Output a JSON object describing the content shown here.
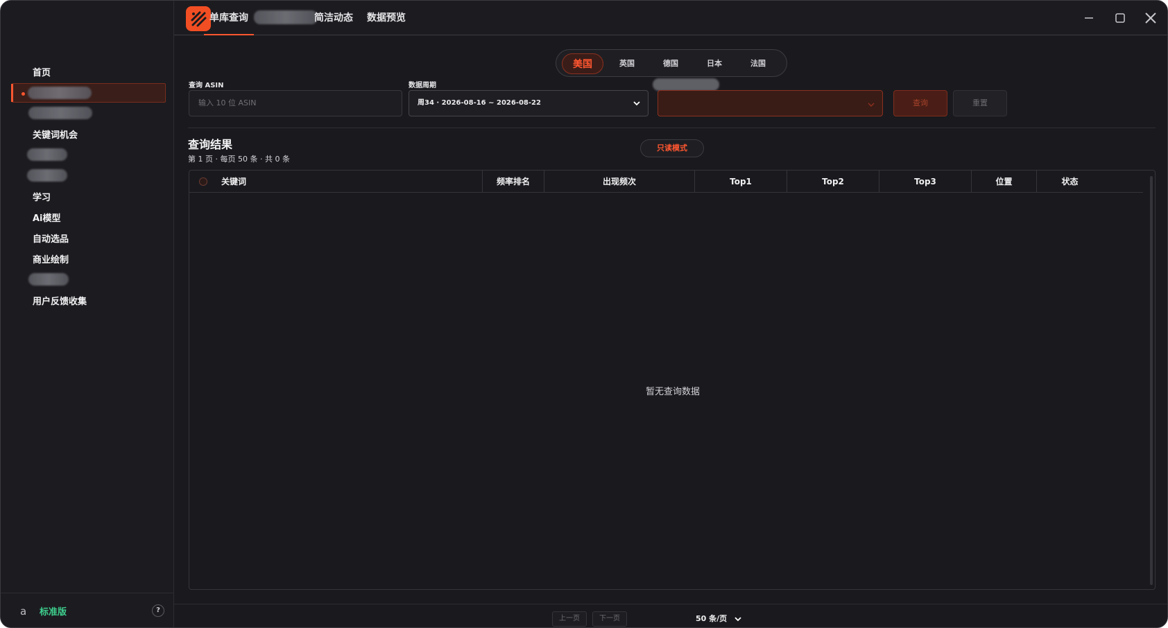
{
  "topbar": {
    "tabs": [
      {
        "label": "单库查询",
        "active": true
      },
      {
        "label": "",
        "blurred": true
      },
      {
        "label": "简洁动态"
      },
      {
        "label": "数据预览"
      }
    ]
  },
  "sidebar": {
    "items": [
      {
        "label": "首页"
      },
      {
        "label": "",
        "blurred": true,
        "active": true
      },
      {
        "label": "",
        "blurred": true
      },
      {
        "label": "关键词机会"
      },
      {
        "label": "",
        "blurred": true
      },
      {
        "label": "",
        "blurred": true
      },
      {
        "label": "学习"
      },
      {
        "label": "Ai模型"
      },
      {
        "label": "自动选品"
      },
      {
        "label": "商业绘制"
      },
      {
        "label": "",
        "blurred": true
      },
      {
        "label": "用户反馈收集"
      }
    ],
    "footer": {
      "edition": "标准版",
      "help": "?",
      "amazon_icon": "a"
    }
  },
  "countries": [
    "美国",
    "英国",
    "德国",
    "日本",
    "法国"
  ],
  "form": {
    "asin_label": "查询 ASIN",
    "asin_placeholder": "输入 10 位 ASIN",
    "period_label": "数据周期",
    "period_value": "周34 · 2026-08-16 ~ 2026-08-22",
    "query_button": "查询",
    "reset_button": "重置"
  },
  "results": {
    "title": "查询结果",
    "subtitle": "第 1 页 · 每页 50 条 · 共 0 条",
    "readonly_badge": "只读模式",
    "columns": [
      "关键词",
      "频率排名",
      "出现频次",
      "Top1",
      "Top2",
      "Top3",
      "位置",
      "状态"
    ],
    "empty_text": "暂无查询数据"
  },
  "pager": {
    "prev": "上一页",
    "next": "下一页",
    "page_size": "50 条/页"
  },
  "colors": {
    "accent": "#ff5630",
    "edition": "#3ecf8e",
    "background": "#1a1a1e"
  }
}
